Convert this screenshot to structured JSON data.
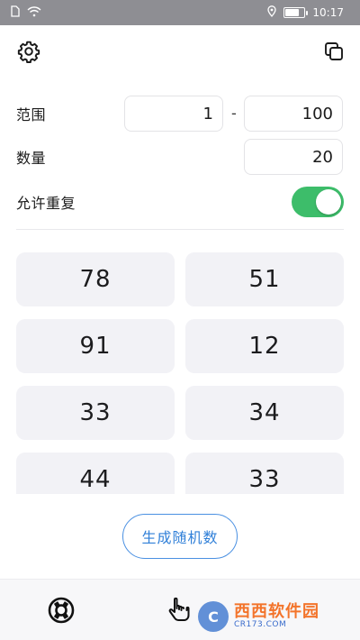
{
  "status_bar": {
    "time": "10:17",
    "icons": [
      "sim-icon",
      "wifi-icon",
      "location-icon",
      "battery-icon"
    ]
  },
  "toolbar": {
    "settings_icon": "gear-icon",
    "copy_icon": "copy-icon"
  },
  "form": {
    "range_label": "范围",
    "range_min": "1",
    "range_separator": "-",
    "range_max": "100",
    "count_label": "数量",
    "count_value": "20",
    "allow_repeat_label": "允许重复",
    "allow_repeat_enabled": true
  },
  "results": {
    "numbers": [
      "78",
      "51",
      "91",
      "12",
      "33",
      "34",
      "44",
      "33"
    ]
  },
  "actions": {
    "generate_label": "生成随机数"
  },
  "bottom_bar": {
    "icons": [
      "lifebuoy-icon",
      "hand-pointer-icon"
    ]
  },
  "watermark": {
    "main": "西西软件园",
    "sub": "CR173.COM"
  },
  "colors": {
    "accent_blue": "#2f7fd8",
    "toggle_green": "#3dbd6a",
    "cell_bg": "#f2f2f6",
    "status_bar_bg": "#8e8e93"
  }
}
